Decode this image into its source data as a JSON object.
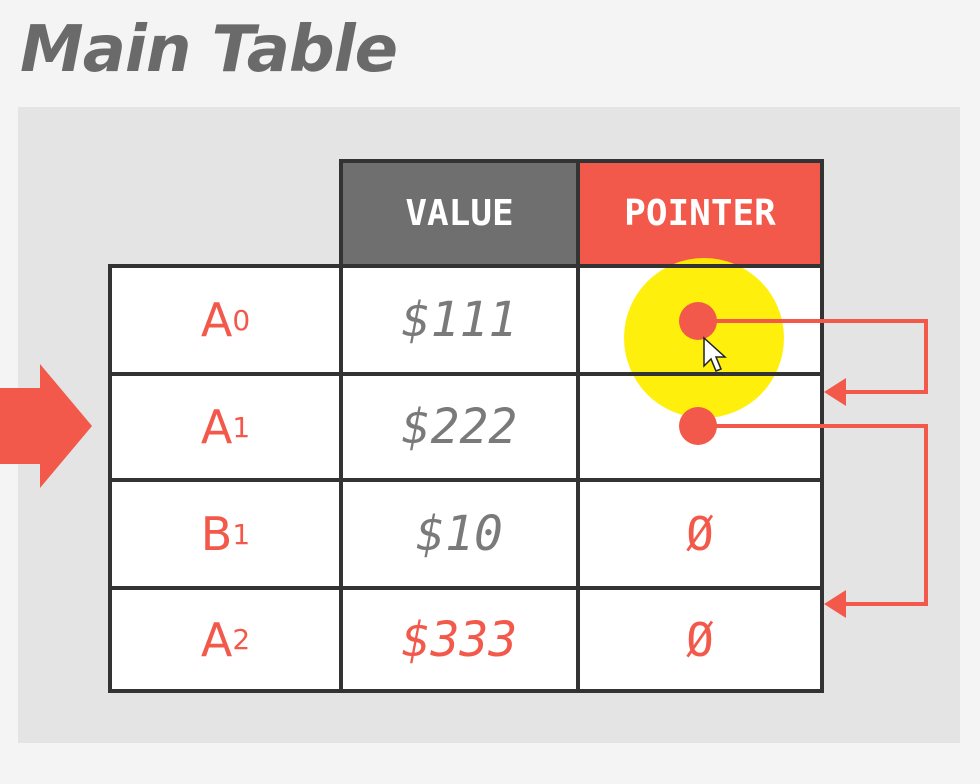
{
  "title": "Main Table",
  "headers": {
    "value": "VALUE",
    "pointer": "POINTER"
  },
  "rows": [
    {
      "key": "A",
      "sub": "0",
      "value": "$111",
      "pointer": "",
      "value_color": "gray"
    },
    {
      "key": "A",
      "sub": "1",
      "value": "$222",
      "pointer": "",
      "value_color": "gray"
    },
    {
      "key": "B",
      "sub": "1",
      "value": "$10",
      "pointer": "Ø",
      "value_color": "gray"
    },
    {
      "key": "A",
      "sub": "2",
      "value": "$333",
      "pointer": "Ø",
      "value_color": "red"
    }
  ],
  "colors": {
    "accent": "#f2594b",
    "header_gray": "#6f6f6f",
    "cursor_highlight": "#ffee00"
  }
}
